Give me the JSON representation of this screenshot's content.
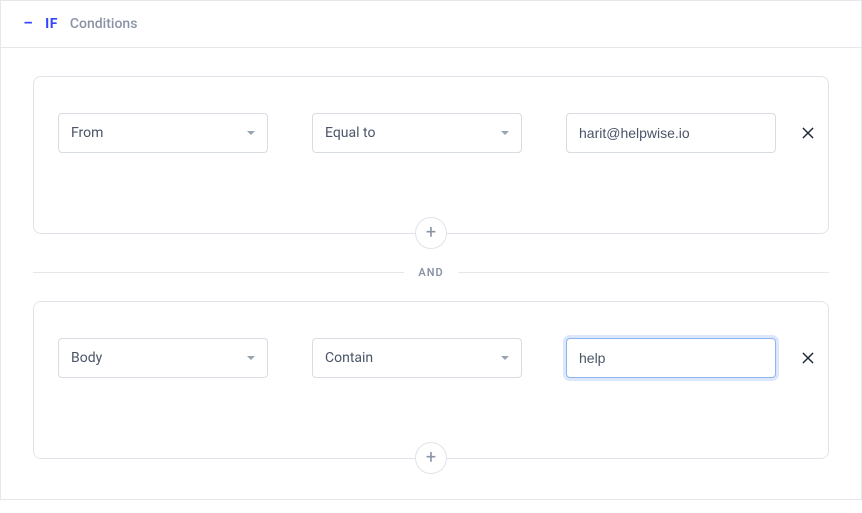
{
  "header": {
    "if_label": "IF",
    "conditions_label": "Conditions"
  },
  "separator_label": "AND",
  "conditions": [
    {
      "field": "From",
      "operator": "Equal to",
      "value": "harit@helpwise.io",
      "value_focused": false
    },
    {
      "field": "Body",
      "operator": "Contain",
      "value": "help",
      "value_focused": true
    }
  ]
}
